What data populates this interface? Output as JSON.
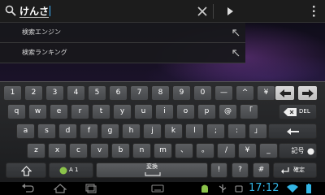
{
  "search": {
    "query_underlined": "けん",
    "query_rest": "さ"
  },
  "suggestions": [
    {
      "label": "検索エンジン"
    },
    {
      "label": "検索ランキング"
    }
  ],
  "keyboard": {
    "row1": [
      "1",
      "2",
      "3",
      "4",
      "5",
      "6",
      "7",
      "8",
      "9",
      "0",
      "—",
      "^",
      "¥"
    ],
    "row2": [
      "q",
      "w",
      "e",
      "r",
      "t",
      "y",
      "u",
      "i",
      "o",
      "p",
      "@",
      "「"
    ],
    "row3": [
      "a",
      "s",
      "d",
      "f",
      "g",
      "h",
      "j",
      "k",
      "l",
      ";",
      ":",
      "」"
    ],
    "row4": [
      "z",
      "x",
      "c",
      "v",
      "b",
      "n",
      "m",
      "、",
      "。",
      "/",
      "¥",
      "_"
    ],
    "delete_label": "DEL",
    "symbol_label": "記号",
    "mode_label": "A 1",
    "convert_label": "変換",
    "exclaim": "!",
    "question": "?",
    "hash": "#",
    "enter_label": "確定"
  },
  "statusbar": {
    "time": "17:12"
  },
  "colors": {
    "accent": "#33b5e5",
    "keyboard_bg": "#232426",
    "key": "#505255"
  }
}
